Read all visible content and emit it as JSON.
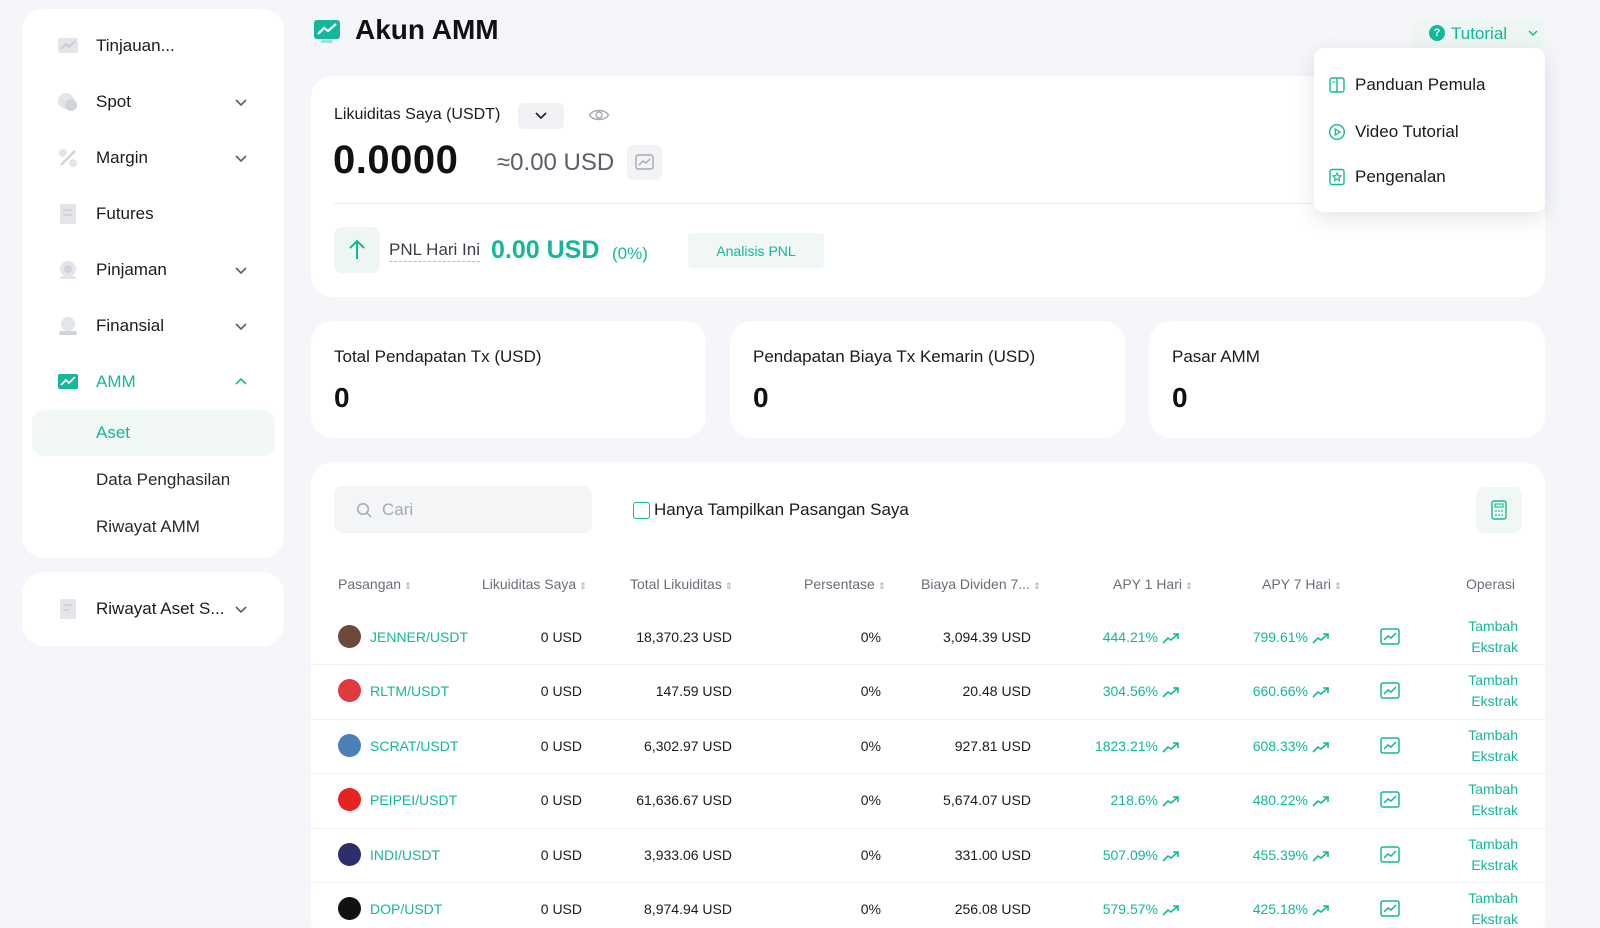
{
  "sidebar": {
    "items": [
      {
        "label": "Tinjauan..."
      },
      {
        "label": "Spot"
      },
      {
        "label": "Margin"
      },
      {
        "label": "Futures"
      },
      {
        "label": "Pinjaman"
      },
      {
        "label": "Finansial"
      },
      {
        "label": "AMM"
      }
    ],
    "sub_items": [
      {
        "label": "Aset"
      },
      {
        "label": "Data Penghasilan"
      },
      {
        "label": "Riwayat AMM"
      }
    ],
    "bottom_item": {
      "label": "Riwayat Aset S..."
    }
  },
  "header": {
    "title": "Akun AMM",
    "tutorial_label": "Tutorial"
  },
  "tutorial_menu": [
    {
      "label": "Panduan Pemula",
      "icon": "book-icon"
    },
    {
      "label": "Video Tutorial",
      "icon": "play-circle-icon"
    },
    {
      "label": "Pengenalan",
      "icon": "star-badge-icon"
    }
  ],
  "liquidity": {
    "label": "Likuiditas Saya (USDT)",
    "value": "0.0000",
    "usd_approx": "≈0.00 USD",
    "pnl_label": "PNL Hari Ini",
    "pnl_value": "0.00 USD",
    "pnl_pct": "(0%)",
    "pnl_button": "Analisis PNL"
  },
  "stats": [
    {
      "label": "Total Pendapatan Tx (USD)",
      "value": "0"
    },
    {
      "label": "Pendapatan Biaya Tx Kemarin (USD)",
      "value": "0"
    },
    {
      "label": "Pasar AMM",
      "value": "0"
    }
  ],
  "filters": {
    "search_placeholder": "Cari",
    "only_mine_label": "Hanya Tampilkan Pasangan Saya"
  },
  "table": {
    "headers": [
      "Pasangan",
      "Likuiditas Saya",
      "Total Likuiditas",
      "Persentase",
      "Biaya Dividen 7...",
      "APY 1 Hari",
      "APY 7 Hari",
      "Operasi"
    ],
    "op_add": "Tambah",
    "op_extract": "Ekstrak",
    "rows": [
      {
        "pair": "JENNER/USDT",
        "my_liq": "0 USD",
        "total_liq": "18,370.23 USD",
        "pct": "0%",
        "fee": "3,094.39 USD",
        "apy1": "444.21%",
        "apy7": "799.61%",
        "avatar_color": "#6b4a3a"
      },
      {
        "pair": "RLTM/USDT",
        "my_liq": "0 USD",
        "total_liq": "147.59 USD",
        "pct": "0%",
        "fee": "20.48 USD",
        "apy1": "304.56%",
        "apy7": "660.66%",
        "avatar_color": "#e0393e"
      },
      {
        "pair": "SCRAT/USDT",
        "my_liq": "0 USD",
        "total_liq": "6,302.97 USD",
        "pct": "0%",
        "fee": "927.81 USD",
        "apy1": "1823.21%",
        "apy7": "608.33%",
        "avatar_color": "#4a7fb8"
      },
      {
        "pair": "PEIPEI/USDT",
        "my_liq": "0 USD",
        "total_liq": "61,636.67 USD",
        "pct": "0%",
        "fee": "5,674.07 USD",
        "apy1": "218.6%",
        "apy7": "480.22%",
        "avatar_color": "#e8221c"
      },
      {
        "pair": "INDI/USDT",
        "my_liq": "0 USD",
        "total_liq": "3,933.06 USD",
        "pct": "0%",
        "fee": "331.00 USD",
        "apy1": "507.09%",
        "apy7": "455.39%",
        "avatar_color": "#2b2e6b"
      },
      {
        "pair": "DOP/USDT",
        "my_liq": "0 USD",
        "total_liq": "8,974.94 USD",
        "pct": "0%",
        "fee": "256.08 USD",
        "apy1": "579.57%",
        "apy7": "425.18%",
        "avatar_color": "#111111"
      }
    ]
  },
  "colors": {
    "accent": "#13b89a",
    "background": "#f4f6fa"
  }
}
